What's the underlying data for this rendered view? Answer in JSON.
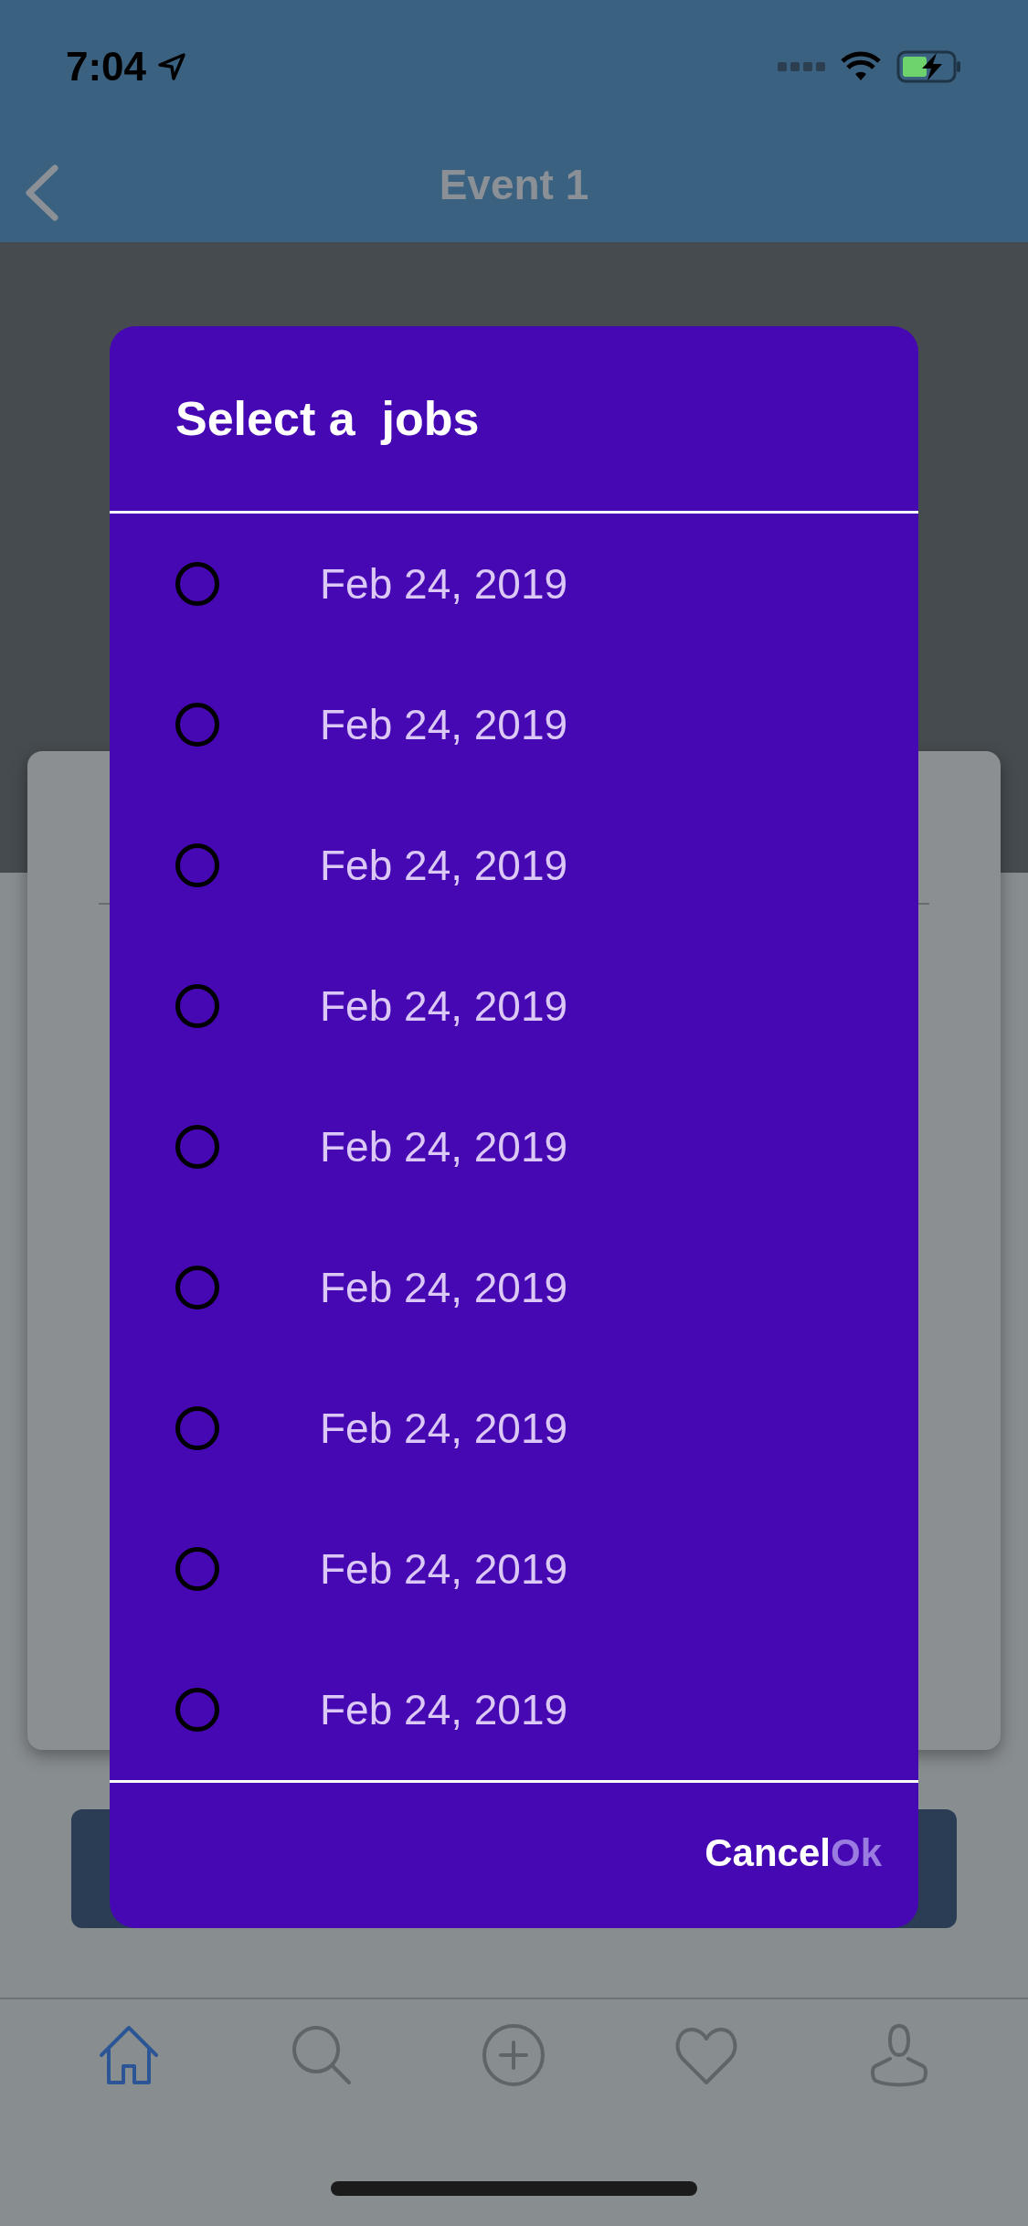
{
  "status_bar": {
    "time": "7:04"
  },
  "nav": {
    "title": "Event 1"
  },
  "dialog": {
    "title": "Select a  jobs",
    "options": [
      {
        "label": "Feb 24, 2019",
        "selected": false
      },
      {
        "label": "Feb 24, 2019",
        "selected": false
      },
      {
        "label": "Feb 24, 2019",
        "selected": false
      },
      {
        "label": "Feb 24, 2019",
        "selected": false
      },
      {
        "label": "Feb 24, 2019",
        "selected": false
      },
      {
        "label": "Feb 24, 2019",
        "selected": false
      },
      {
        "label": "Feb 24, 2019",
        "selected": false
      },
      {
        "label": "Feb 24, 2019",
        "selected": false
      },
      {
        "label": "Feb 24, 2019",
        "selected": false
      }
    ],
    "buttons": [
      {
        "label": "Cancel",
        "disabled": false
      },
      {
        "label": "Ok",
        "disabled": true
      }
    ]
  },
  "tab_bar": [
    {
      "kind": "home",
      "selected": true
    },
    {
      "kind": "search",
      "selected": false
    },
    {
      "kind": "add",
      "selected": false
    },
    {
      "kind": "heart",
      "selected": false
    },
    {
      "kind": "profile",
      "selected": false
    }
  ]
}
